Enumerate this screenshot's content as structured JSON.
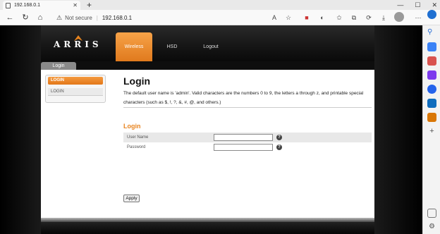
{
  "browser": {
    "tab_title": "192.168.0.1",
    "tab_close": "✕",
    "new_tab": "+",
    "window_controls": [
      "—",
      "☐",
      "✕"
    ],
    "back_icon": "←",
    "refresh_icon": "↻",
    "home_icon": "⌂",
    "security_label": "Not secure",
    "separator": "|",
    "url": "192.168.0.1",
    "menu_icon": "⋯"
  },
  "header": {
    "logo_text": "ARRIS",
    "nav": [
      {
        "label": "Wireless",
        "active": true
      },
      {
        "label": "HSD",
        "active": false
      },
      {
        "label": "Logout",
        "active": false
      }
    ]
  },
  "subnav": {
    "tab_label": "Login"
  },
  "sidebar": {
    "active_label": "LOGIN",
    "item_label": "LOGIN"
  },
  "main": {
    "title": "Login",
    "description": "The default user name is 'admin'. Valid characters are the numbers 0 to 9, the letters a through z, and printable special characters (such as $, !, ?, &, #, @, and others.)",
    "section_title": "Login",
    "fields": [
      {
        "label": "User Name",
        "value": ""
      },
      {
        "label": "Password",
        "value": ""
      }
    ],
    "help_icon": "?",
    "apply_label": "Apply"
  },
  "colors": {
    "accent_orange": "#e8841f",
    "header_dark": "#151515"
  }
}
